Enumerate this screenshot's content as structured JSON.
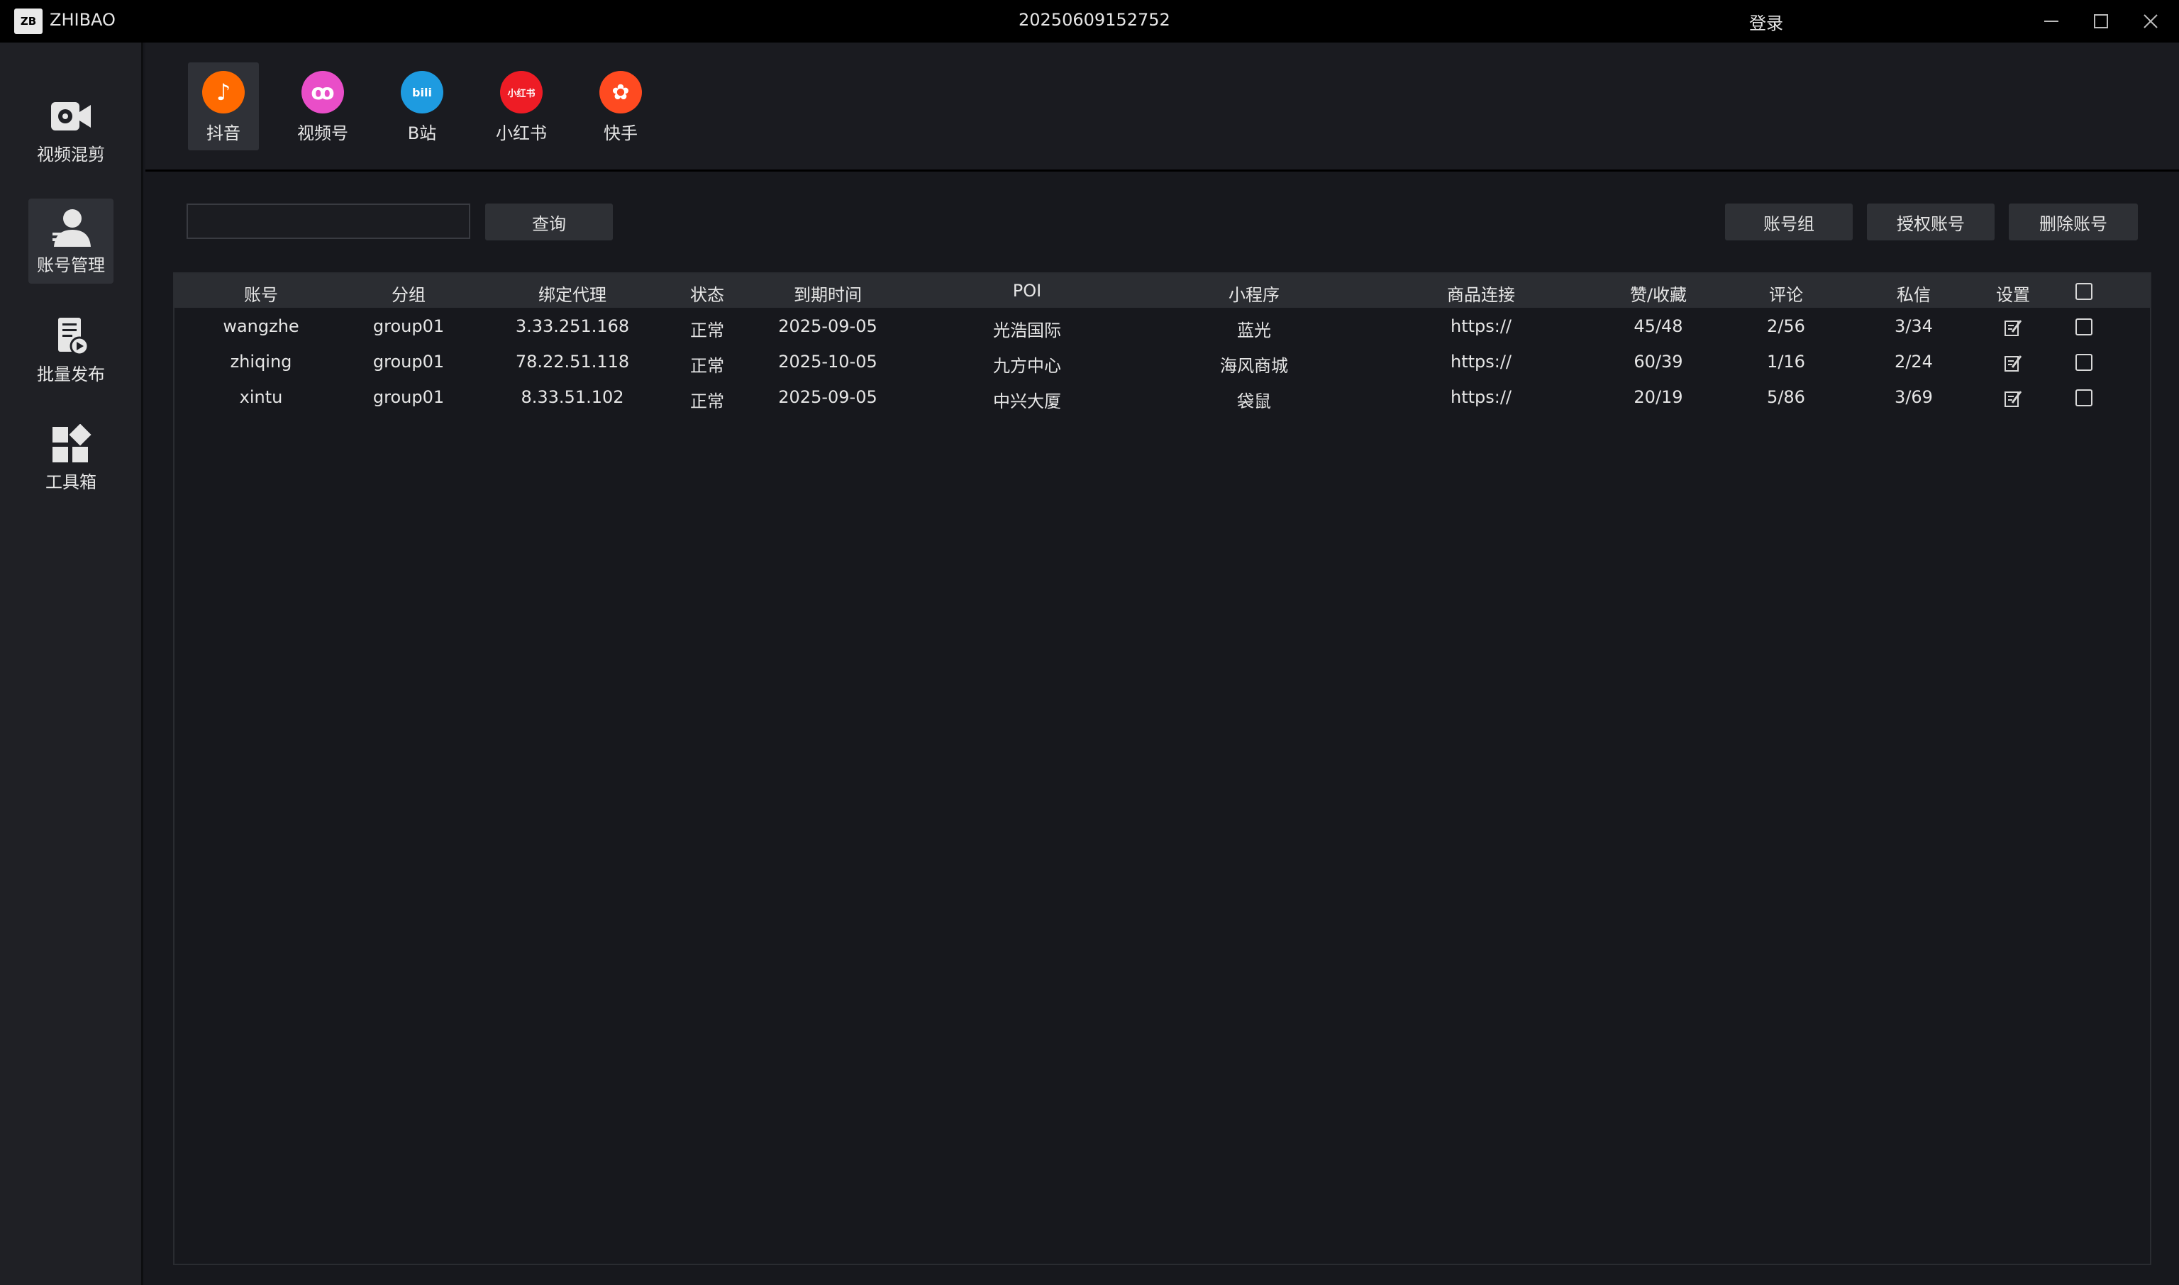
{
  "titlebar": {
    "app_logo_text": "ZB",
    "app_name": "ZHIBAO",
    "window_title": "20250609152752",
    "login": "登录"
  },
  "sidebar": {
    "items": [
      {
        "label": "视频混剪",
        "icon": "video-edit-icon"
      },
      {
        "label": "账号管理",
        "icon": "user-icon",
        "active": true
      },
      {
        "label": "批量发布",
        "icon": "batch-publish-icon"
      },
      {
        "label": "工具箱",
        "icon": "toolbox-icon"
      }
    ]
  },
  "platforms": [
    {
      "label": "抖音",
      "glyph": "♪",
      "color": "#ff6a00",
      "active": true
    },
    {
      "label": "视频号",
      "glyph": "ꝏ",
      "color": "#e94ec8"
    },
    {
      "label": "B站",
      "glyph": "bili",
      "color": "#1e9be0"
    },
    {
      "label": "小红书",
      "glyph": "小红书",
      "color": "#ee1c25"
    },
    {
      "label": "快手",
      "glyph": "✿",
      "color": "#ff4a20"
    }
  ],
  "toolbar": {
    "search_value": "",
    "search_placeholder": "",
    "query": "查询",
    "account_group": "账号组",
    "authorize": "授权账号",
    "delete": "删除账号"
  },
  "table": {
    "headers": [
      "账号",
      "分组",
      "绑定代理",
      "状态",
      "到期时间",
      "POI",
      "小程序",
      "商品连接",
      "赞/收藏",
      "评论",
      "私信",
      "设置"
    ],
    "rows": [
      [
        "wangzhe",
        "group01",
        "3.33.251.168",
        "正常",
        "2025-09-05",
        "光浩国际",
        "蓝光",
        "https://",
        "45/48",
        "2/56",
        "3/34"
      ],
      [
        "zhiqing",
        "group01",
        "78.22.51.118",
        "正常",
        "2025-10-05",
        "九方中心",
        "海风商城",
        "https://",
        "60/39",
        "1/16",
        "2/24"
      ],
      [
        "xintu",
        "group01",
        "8.33.51.102",
        "正常",
        "2025-09-05",
        "中兴大厦",
        "袋鼠",
        "https://",
        "20/19",
        "5/86",
        "3/69"
      ]
    ]
  }
}
